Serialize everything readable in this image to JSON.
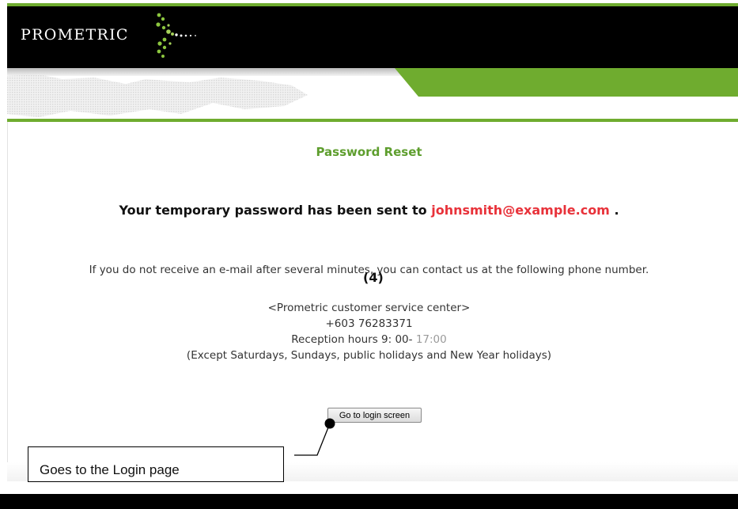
{
  "header": {
    "logo_text": "PROMETRIC"
  },
  "page": {
    "title": "Password Reset",
    "sent_prefix": "Your temporary password has been sent to",
    "email": "johnsmith@example.com",
    "sent_suffix": ".",
    "info_text": "If you do not receive an e-mail after several minutes, you can contact us at the following phone number.",
    "step_marker": "(4)",
    "contact": {
      "center_name": "<Prometric customer service center>",
      "phone": "+603 76283371",
      "hours_label": "Reception hours 9: 00-",
      "hours_end": "17:00",
      "exceptions": "(Except Saturdays, Sundays, public holidays and New Year holidays)"
    },
    "login_button_label": "Go to login screen"
  },
  "annotation": {
    "callout_text": "Goes to the Login page"
  },
  "colors": {
    "brand_green": "#6fac2f",
    "title_green": "#5e9e2e",
    "email_red": "#e8323a"
  }
}
